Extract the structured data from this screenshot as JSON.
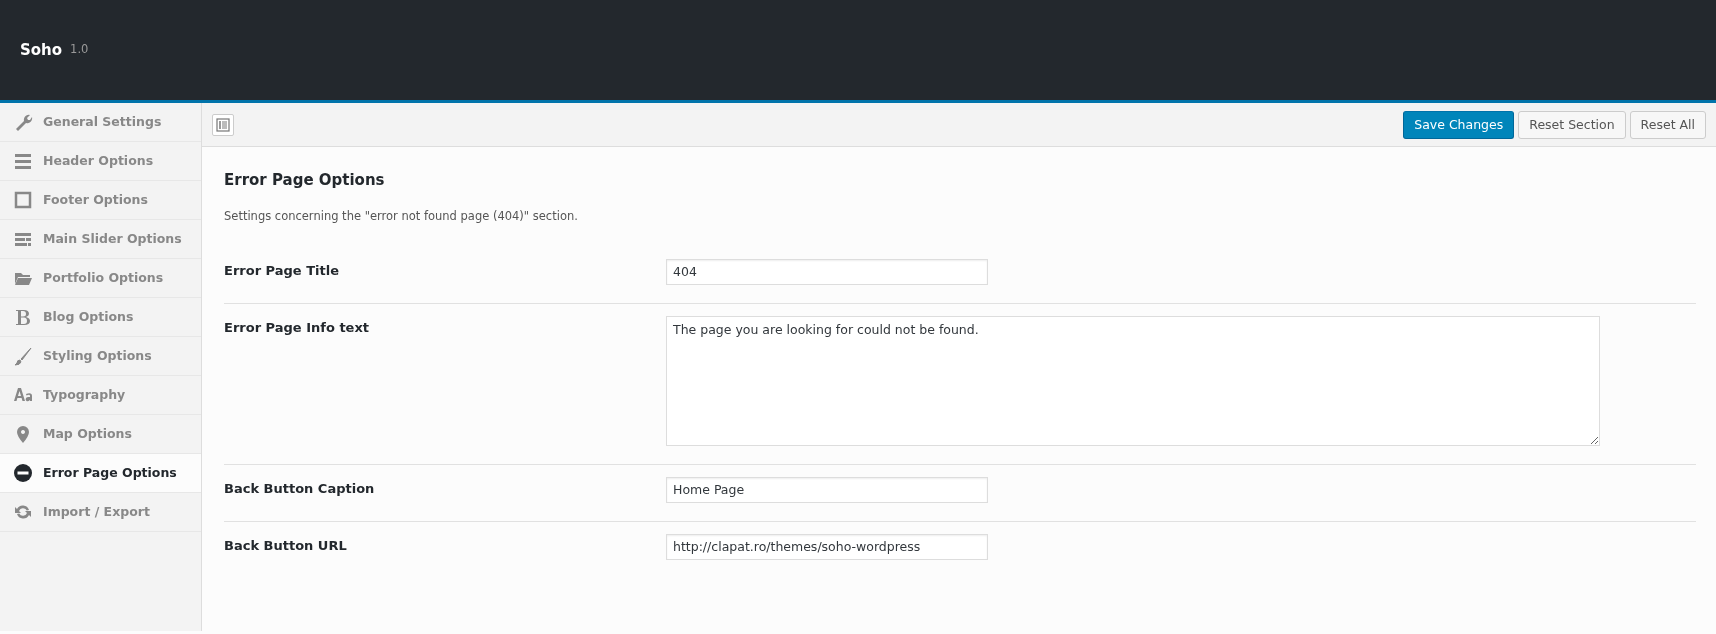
{
  "header": {
    "title": "Soho",
    "version": "1.0"
  },
  "sidebar": {
    "items": [
      {
        "label": "General Settings",
        "selected": false
      },
      {
        "label": "Header Options",
        "selected": false
      },
      {
        "label": "Footer Options",
        "selected": false
      },
      {
        "label": "Main Slider Options",
        "selected": false
      },
      {
        "label": "Portfolio Options",
        "selected": false
      },
      {
        "label": "Blog Options",
        "selected": false
      },
      {
        "label": "Styling Options",
        "selected": false
      },
      {
        "label": "Typography",
        "selected": false
      },
      {
        "label": "Map Options",
        "selected": false
      },
      {
        "label": "Error Page Options",
        "selected": true
      },
      {
        "label": "Import / Export",
        "selected": false
      }
    ]
  },
  "toolbar": {
    "buttons": [
      {
        "label": "Save Changes",
        "kind": "primary"
      },
      {
        "label": "Reset Section",
        "kind": "secondary"
      },
      {
        "label": "Reset All",
        "kind": "secondary"
      }
    ]
  },
  "section": {
    "title": "Error Page Options",
    "description": "Settings concerning the \"error not found page (404)\" section.",
    "fields": [
      {
        "label": "Error Page Title",
        "kind": "input",
        "value": "404"
      },
      {
        "label": "Error Page Info text",
        "kind": "textarea",
        "value": "The page you are looking for could not be found."
      },
      {
        "label": "Back Button Caption",
        "kind": "input",
        "value": "Home Page"
      },
      {
        "label": "Back Button URL",
        "kind": "input",
        "value": "http://clapat.ro/themes/soho-wordpress"
      }
    ]
  }
}
